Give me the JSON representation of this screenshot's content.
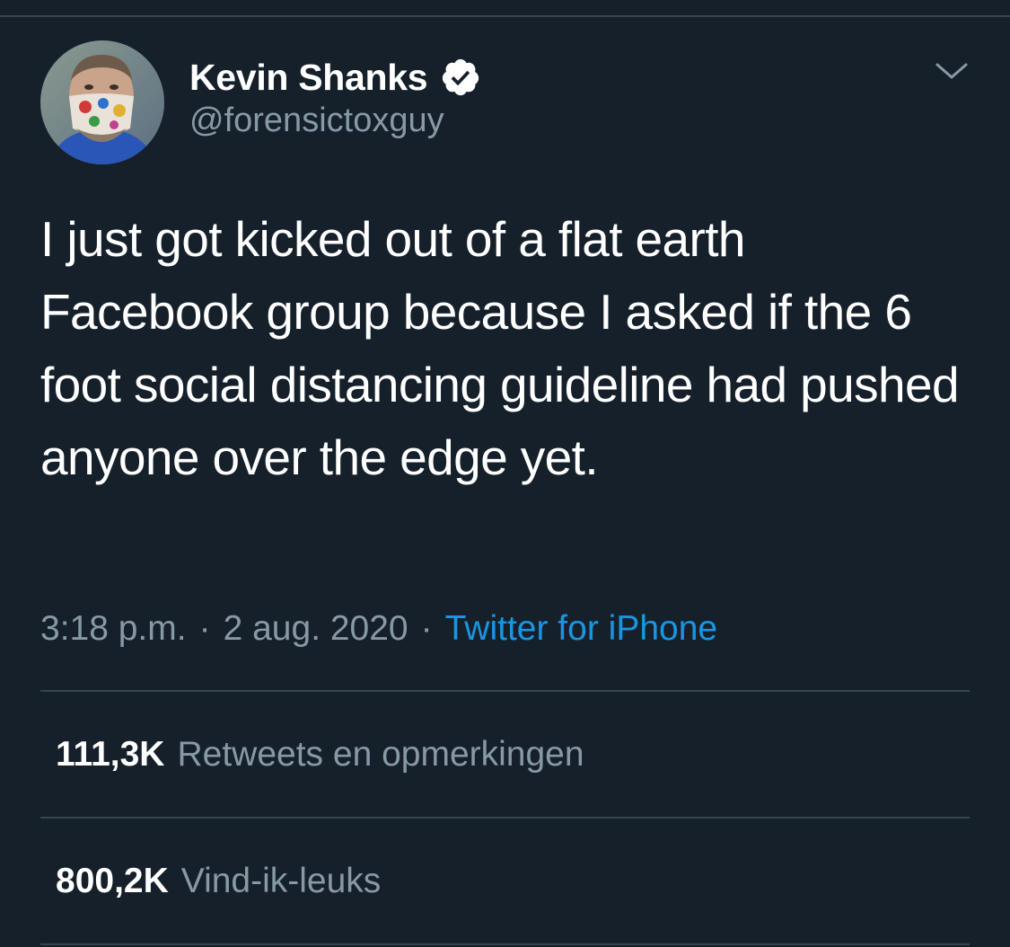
{
  "tweet": {
    "author": {
      "display_name": "Kevin Shanks",
      "handle": "@forensictoxguy",
      "verified": true,
      "verified_icon": "verified-badge-icon",
      "avatar_icon": "avatar-photo"
    },
    "text": "I just got kicked out of a flat earth Facebook group because I asked if the 6 foot social distancing guideline had pushed anyone over the edge yet.",
    "time": "3:18 p.m.",
    "separator": "·",
    "date": "2 aug. 2020",
    "source": "Twitter for iPhone",
    "menu_icon": "chevron-down-icon"
  },
  "stats": {
    "retweets": {
      "count": "111,3K",
      "label": "Retweets en opmerkingen"
    },
    "likes": {
      "count": "800,2K",
      "label": "Vind-ik-leuks"
    }
  },
  "colors": {
    "background": "#15202b",
    "divider": "#38444d",
    "secondary_text": "#8899a6",
    "link": "#1b95e0",
    "primary_text": "#ffffff"
  }
}
